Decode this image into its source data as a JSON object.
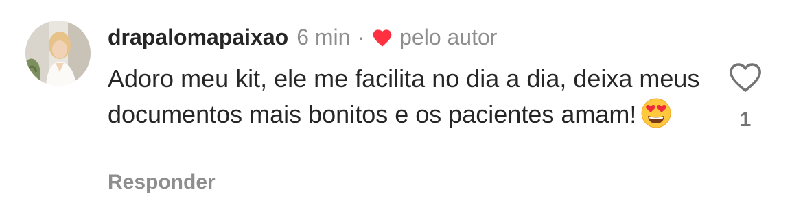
{
  "comment": {
    "username": "drapalomapaixao",
    "time": "6 min",
    "separator": "·",
    "liked_by_author_label": "pelo autor",
    "text": "Adoro meu kit, ele me facilita no dia a dia, deixa meus documentos mais bonitos e os pacientes amam!",
    "emoji": "heart-eyes-emoji",
    "reply_label": "Responder",
    "like_count": "1"
  },
  "colors": {
    "text_primary": "#262626",
    "text_secondary": "#8e8e8e",
    "author_heart": "#ff3040",
    "like_outline": "#737373"
  },
  "icons": {
    "author_like": "heart-filled-icon",
    "like": "heart-outline-icon"
  }
}
